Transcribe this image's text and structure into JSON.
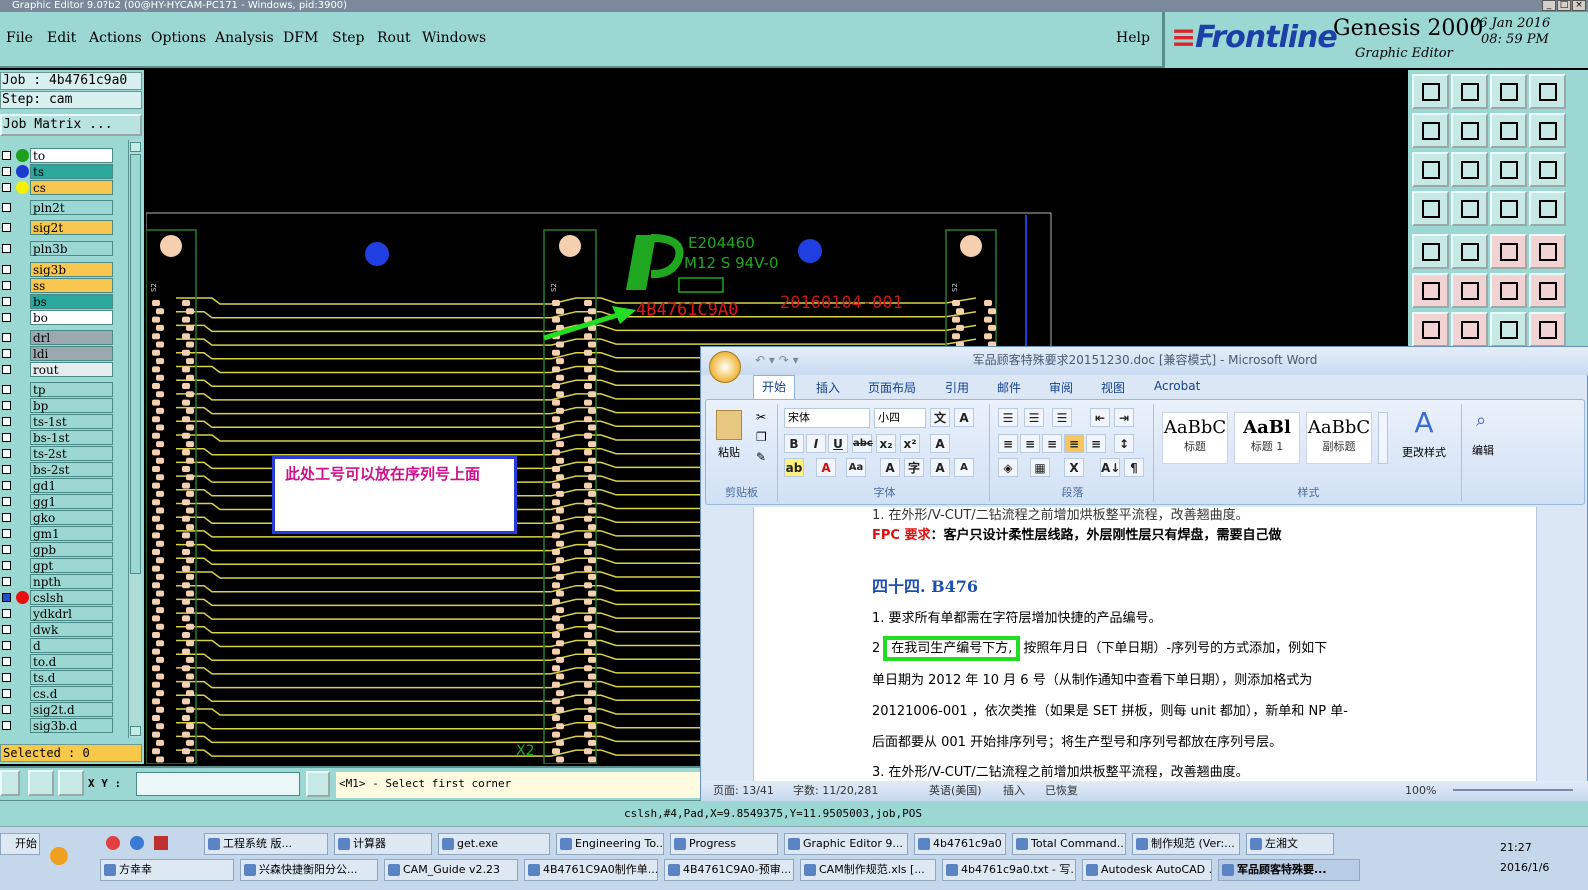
{
  "app": {
    "title": "Graphic Editor 9.0?b2 (00@HY-HYCAM-PC171 - Windows, pid:3900)"
  },
  "menu": {
    "items": [
      "File",
      "Edit",
      "Actions",
      "Options",
      "Analysis",
      "DFM",
      "Step",
      "Rout",
      "Windows"
    ],
    "help": "Help"
  },
  "brand": {
    "company": "Frontline",
    "product": "Genesis 2000",
    "subtitle": "Graphic Editor",
    "date": "06 Jan 2016",
    "time": "08: 59 PM"
  },
  "job": {
    "job_label": "Job : 4b4761c9a0",
    "step_label": "Step: cam",
    "matrix_button": "Job Matrix ..."
  },
  "layers": [
    {
      "name": "to",
      "color": "#ffffff",
      "dot": "#1e9e1e"
    },
    {
      "name": "ts",
      "color": "#2aa89c",
      "dot": "#1b3bd0"
    },
    {
      "name": "cs",
      "color": "#f9c750",
      "dot": "#f5f000"
    },
    {
      "name": "pln2t",
      "color": "#9bd8d4",
      "dot": ""
    },
    {
      "name": "sig2t",
      "color": "#f9c750",
      "dot": ""
    },
    {
      "name": "pln3b",
      "color": "#9bd8d4",
      "dot": ""
    },
    {
      "name": "sig3b",
      "color": "#f9c750",
      "dot": ""
    },
    {
      "name": "ss",
      "color": "#f9c750",
      "dot": ""
    },
    {
      "name": "bs",
      "color": "#2aa89c",
      "dot": ""
    },
    {
      "name": "bo",
      "color": "#ffffff",
      "dot": ""
    },
    {
      "name": "drl",
      "color": "#9aa8b0",
      "dot": ""
    },
    {
      "name": "ldi",
      "color": "#9aa8b0",
      "dot": ""
    },
    {
      "name": "rout",
      "color": "#e4ecec",
      "dot": ""
    },
    {
      "name": "tp",
      "color": "#9bd8d4",
      "dot": ""
    },
    {
      "name": "bp",
      "color": "#9bd8d4",
      "dot": ""
    },
    {
      "name": "ts-1st",
      "color": "#9bd8d4",
      "dot": ""
    },
    {
      "name": "bs-1st",
      "color": "#9bd8d4",
      "dot": ""
    },
    {
      "name": "ts-2st",
      "color": "#9bd8d4",
      "dot": ""
    },
    {
      "name": "bs-2st",
      "color": "#9bd8d4",
      "dot": ""
    },
    {
      "name": "gd1",
      "color": "#9bd8d4",
      "dot": ""
    },
    {
      "name": "gg1",
      "color": "#9bd8d4",
      "dot": ""
    },
    {
      "name": "gko",
      "color": "#9bd8d4",
      "dot": ""
    },
    {
      "name": "gm1",
      "color": "#9bd8d4",
      "dot": ""
    },
    {
      "name": "gpb",
      "color": "#9bd8d4",
      "dot": ""
    },
    {
      "name": "gpt",
      "color": "#9bd8d4",
      "dot": ""
    },
    {
      "name": "npth",
      "color": "#9bd8d4",
      "dot": ""
    },
    {
      "name": "cslsh",
      "color": "#9bd8d4",
      "dot": "#e81010",
      "selected": true
    },
    {
      "name": "ydkdrl",
      "color": "#9bd8d4",
      "dot": ""
    },
    {
      "name": "dwk",
      "color": "#9bd8d4",
      "dot": ""
    },
    {
      "name": "d",
      "color": "#9bd8d4",
      "dot": ""
    },
    {
      "name": "to.d",
      "color": "#9bd8d4",
      "dot": ""
    },
    {
      "name": "ts.d",
      "color": "#9bd8d4",
      "dot": ""
    },
    {
      "name": "cs.d",
      "color": "#9bd8d4",
      "dot": ""
    },
    {
      "name": "sig2t.d",
      "color": "#9bd8d4",
      "dot": ""
    },
    {
      "name": "sig3b.d",
      "color": "#9bd8d4",
      "dot": ""
    }
  ],
  "selected": "Selected : 0",
  "canvas": {
    "ul_code": "E204460",
    "ul_rating": "M12 S 94V-0",
    "job_mark": "4B4761C9A0",
    "date_code": "20160104-001",
    "note": "此处工号可以放在序列号上面",
    "step_label": "X2",
    "col_label_1": "S2",
    "col_label_2": "S2",
    "col_label_3": "S2"
  },
  "command": {
    "xy_label": "X Y :",
    "xy_value": "",
    "prompt": "<M1> - Select first corner"
  },
  "status": {
    "text": "cslsh,#4,Pad,X=9.8549375,Y=11.9505003,job,POS"
  },
  "word": {
    "title": "军品顾客特殊要求20151230.doc [兼容模式] - Microsoft Word",
    "tabs": [
      "开始",
      "插入",
      "页面布局",
      "引用",
      "邮件",
      "审阅",
      "视图",
      "Acrobat"
    ],
    "font_name": "宋体",
    "font_size": "小四",
    "groups": {
      "clipboard": "剪贴板",
      "font": "字体",
      "paragraph": "段落",
      "styles": "样式",
      "edit": "编辑",
      "paste": "粘贴",
      "change_styles": "更改样式"
    },
    "styles": [
      {
        "sample": "AaBbC",
        "name": "标题"
      },
      {
        "sample": "AaBl",
        "name": "标题 1"
      },
      {
        "sample": "AaBbC",
        "name": "副标题"
      }
    ],
    "doc": {
      "line0": "1. 在外形/V-CUT/二钻流程之前增加烘板整平流程，改善翘曲度。",
      "fpc_label": "FPC 要求",
      "fpc_text": "：客户只设计柔性层线路，外层刚性层只有焊盘，需要自己做",
      "heading": "四十四. B476",
      "l1": "1. 要求所有单都需在字符层增加快捷的产品编号。",
      "l2_num": "2",
      "l2_box": "在我司生产编号下方,",
      "l2_rest": "按照年月日（下单日期）-序列号的方式添加，例如下",
      "l3": "单日期为  2012  年  10  月  6  号（从制作通知中查看下单日期），则添加格式为",
      "l4": "20121006-001 ，依次类推（如果是 SET 拼板，则每 unit 都加），新单和 NP 单-",
      "l5": "后面都要从 001 开始排序列号；将生产型号和序列号都放在序列号层。",
      "l6": "3. 在外形/V-CUT/二钻流程之前增加烘板整平流程，改善翘曲度。"
    },
    "status": {
      "page": "页面: 13/41",
      "words": "字数: 11/20,281",
      "lang": "英语(美国)",
      "insert": "插入",
      "recovered": "已恢复",
      "zoom": "100%"
    }
  },
  "taskbar": {
    "start": "开始",
    "row1": [
      "工程系统  版...",
      "计算器",
      "get.exe",
      "Engineering To...",
      "Progress",
      "Graphic Editor 9...",
      "4b4761c9a0 - ...",
      "Total Command...",
      "制作规范 (Ver:...",
      "左湘文"
    ],
    "row2": [
      "方幸幸",
      "兴森快捷衡阳分公...",
      "CAM_Guide v2.23",
      "4B4761C9A0制作单...",
      "4B4761C9A0-预审...",
      "CAM制作规范.xls [...",
      "4b4761c9a0.txt - 写...",
      "Autodesk AutoCAD ...",
      "军品顾客特殊要..."
    ],
    "clock_time": "21:27",
    "clock_date": "2016/1/6"
  }
}
